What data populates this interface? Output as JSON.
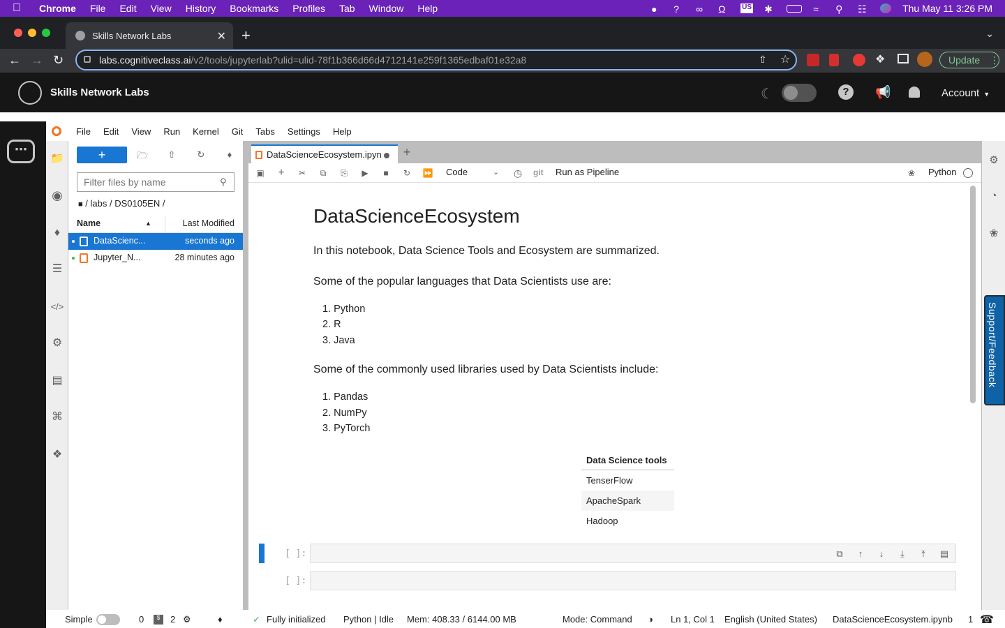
{
  "mac": {
    "app": "Chrome",
    "menus": [
      "File",
      "Edit",
      "View",
      "History",
      "Bookmarks",
      "Profiles",
      "Tab",
      "Window",
      "Help"
    ],
    "clock": "Thu May 11  3:26 PM"
  },
  "browser": {
    "tab_title": "Skills Network Labs",
    "url_host": "labs.cognitiveclass.ai",
    "url_path": "/v2/tools/jupyterlab?ulid=ulid-78f1b366d66d4712141e259f1365edbaf01e32a8",
    "update_label": "Update"
  },
  "site": {
    "title": "Skills Network Labs",
    "account": "Account"
  },
  "jupyter": {
    "menus": [
      "File",
      "Edit",
      "View",
      "Run",
      "Kernel",
      "Git",
      "Tabs",
      "Settings",
      "Help"
    ],
    "filter_placeholder": "Filter files by name",
    "breadcrumb": "/ labs / DS0105EN /",
    "col_name": "Name",
    "col_modified": "Last Modified",
    "files": [
      {
        "name": "DataScienc...",
        "modified": "seconds ago",
        "selected": true
      },
      {
        "name": "Jupyter_N...",
        "modified": "28 minutes ago",
        "selected": false
      }
    ],
    "notebook_tab": "DataScienceEcosystem.ipyn",
    "cell_type": "Code",
    "git_label": "git",
    "pipeline_label": "Run as Pipeline",
    "kernel_label": "Python"
  },
  "notebook": {
    "heading": "DataScienceEcosystem",
    "intro": "In this notebook, Data Science Tools and Ecosystem are summarized.",
    "languages_intro": "Some of the popular languages that Data Scientists use are:",
    "languages": [
      "1.  Python",
      "2.  R",
      "3.  Java"
    ],
    "libraries_intro": "Some of the commonly used libraries used by Data Scientists include:",
    "libraries": [
      "1.  Pandas",
      "2.  NumPy",
      "3.  PyTorch"
    ],
    "table_header": "Data Science tools",
    "table_rows": [
      "TenserFlow",
      "ApacheSpark",
      "Hadoop"
    ],
    "prompt1": "[ ]:",
    "prompt2": "[ ]:"
  },
  "sidebar_right": {
    "support": "Support/Feedback"
  },
  "statusbar": {
    "simple": "Simple",
    "count0": "0",
    "count2": "2",
    "init": "Fully initialized",
    "kernel": "Python | Idle",
    "mem": "Mem: 408.33 / 6144.00 MB",
    "mode": "Mode: Command",
    "pos": "Ln 1, Col 1",
    "lang": "English (United States)",
    "file": "DataScienceEcosystem.ipynb",
    "num": "1"
  },
  "colors": {
    "mac_bar": "#6a22b8",
    "accent": "#1976d2",
    "jupyter_orange": "#f37726",
    "support": "#0f62a5"
  }
}
